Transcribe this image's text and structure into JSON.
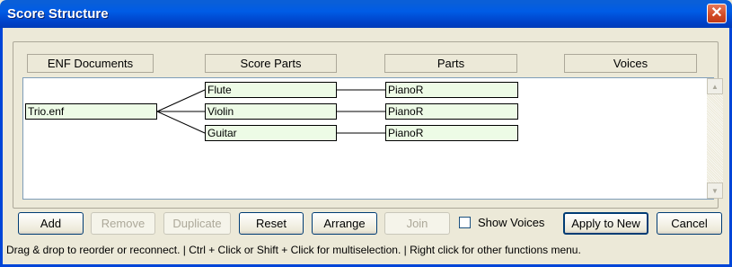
{
  "window": {
    "title": "Score Structure",
    "close_icon": "close-icon"
  },
  "columns": [
    "ENF Documents",
    "Score Parts",
    "Parts",
    "Voices"
  ],
  "tree": {
    "document": "Trio.enf",
    "score_parts": [
      "Flute",
      "Violin",
      "Guitar"
    ],
    "parts": [
      "PianoR",
      "PianoR",
      "PianoR"
    ]
  },
  "buttons": {
    "add": "Add",
    "remove": "Remove",
    "duplicate": "Duplicate",
    "reset": "Reset",
    "arrange": "Arrange",
    "join": "Join",
    "apply_to_new": "Apply to New",
    "cancel": "Cancel"
  },
  "show_voices": {
    "label": "Show Voices",
    "checked": false
  },
  "hint": "Drag & drop to reorder or reconnect. | Ctrl + Click or Shift + Click for multiselection. | Right click for other functions menu."
}
